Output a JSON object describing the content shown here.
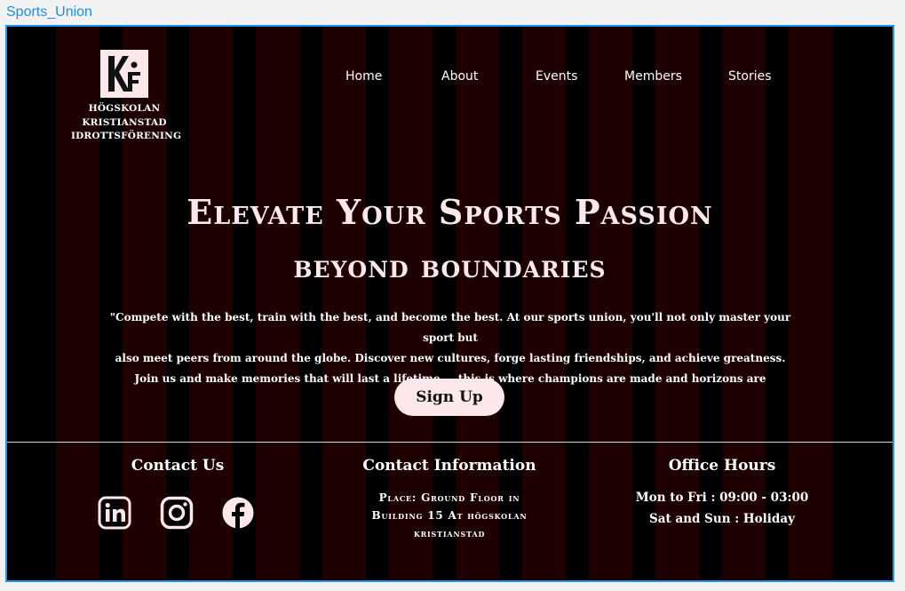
{
  "frame": {
    "label": "Sports_Union"
  },
  "logo": {
    "line1": "HÖGSKOLAN",
    "line2": "KRISTIANSTAD",
    "line3": "IDROTTSFÖRENING"
  },
  "nav": {
    "items": [
      "Home",
      "About",
      "Events",
      "Members",
      "Stories"
    ]
  },
  "hero": {
    "title_line1": "Elevate Your Sports Passion",
    "title_line2": "beyond boundaries",
    "quote_line1": "\"Compete with the best, train with the best, and become the best. At our sports union, you'll not only master your sport but",
    "quote_line2": "also meet peers from around the globe. Discover new cultures, forge lasting friendships, and achieve greatness.",
    "quote_line3": "Join us and make memories that will last a lifetime — this is where champions are made and horizons are expanded!\"",
    "signup_label": "Sign Up"
  },
  "footer": {
    "contact_us": {
      "title": "Contact Us",
      "icons": [
        "linkedin-icon",
        "instagram-icon",
        "facebook-icon"
      ]
    },
    "contact_info": {
      "title": "Contact Information",
      "line1": "Place: Ground Floor in",
      "line2": "Building 15 At högskolan",
      "line3": "kristianstad"
    },
    "office_hours": {
      "title": "Office Hours",
      "weekdays": "Mon to Fri : 09:00 - 03:00",
      "weekend": "Sat and Sun : Holiday"
    }
  },
  "colors": {
    "accent": "#fce8ea",
    "stripe": "#1f0000",
    "background": "#000000",
    "frame_border": "#2196f3"
  }
}
